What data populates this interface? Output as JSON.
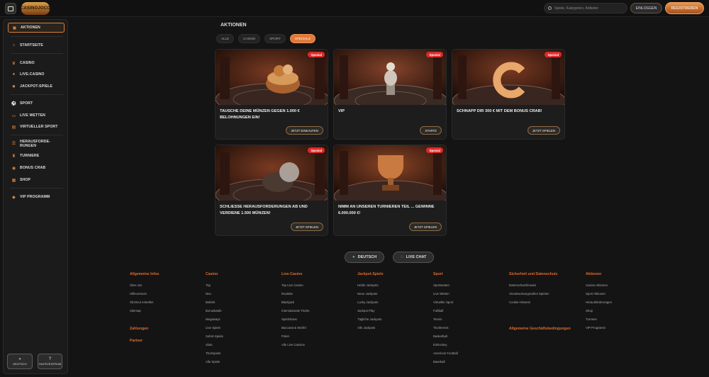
{
  "header": {
    "logo_text": "CASINOJOCO",
    "search_placeholder": "Spiele, Kategorien, Anbieter",
    "login_label": "EINLOGGEN",
    "register_label": "REGISTRIEREN"
  },
  "sidebar": {
    "items": [
      {
        "label": "AKTIONEN",
        "icon": "gift-icon"
      },
      {
        "label": "STARTSEITE",
        "icon": "home-icon"
      },
      {
        "label": "CASINO",
        "icon": "casino-icon"
      },
      {
        "label": "LIVE-CASINO",
        "icon": "live-casino-icon"
      },
      {
        "label": "JACKPOT-SPIELE",
        "icon": "jackpot-icon"
      },
      {
        "label": "SPORT",
        "icon": "sport-icon"
      },
      {
        "label": "LIVE WETTEN",
        "icon": "live-bet-icon"
      },
      {
        "label": "VIRTUELLER SPORT",
        "icon": "virtual-sport-icon"
      },
      {
        "label": "HERAUSFORDE-\nRUNGEN",
        "icon": "challenge-icon"
      },
      {
        "label": "TURNIERE",
        "icon": "trophy-icon"
      },
      {
        "label": "BONUS CRAB",
        "icon": "crab-icon"
      },
      {
        "label": "SHOP",
        "icon": "shop-icon"
      },
      {
        "label": "VIP PROGRAMM",
        "icon": "diamond-icon"
      }
    ],
    "bottom_language": "DEUTSCH",
    "bottom_help": "HILFECENTRUM"
  },
  "main": {
    "title": "AKTIONEN",
    "tabs": [
      "ALLE",
      "CASINO",
      "SPORT",
      "SPECIALS"
    ],
    "cards": [
      {
        "badge": "Spezial",
        "title": "TAUSCHE DEINE MÜNZEN GEGEN 1.000 € BELOHNUNGEN EIN!",
        "cta": "JETZT EINKAUFEN"
      },
      {
        "badge": "Spezial",
        "title": "VIP",
        "cta": "STARTE"
      },
      {
        "badge": "Spezial",
        "title": "SCHNAPP DIR 300 € MIT DEM BONUS CRAB!",
        "cta": "JETZT SPIELEN"
      },
      {
        "badge": "Spezial",
        "title": "SCHLIESSE HERAUSFORDERUNGEN AB UND VERDIENE 1.500 MÜNZEN!",
        "cta": "JETZT SPIELEN"
      },
      {
        "badge": "Spezial",
        "title": "NIMM AN UNSEREN TURNIEREN TEIL ... GEWINNE 6.000.000 €!",
        "cta": "JETZT SPIELEN"
      }
    ]
  },
  "footer": {
    "language_button": "DEUTSCH",
    "chat_button": "LIVE CHAT",
    "columns": [
      {
        "heading": "Allgemeine Infos",
        "links": [
          "Über uns",
          "Hilfecentrum",
          "Shortcut erstellen",
          "Sitemap"
        ]
      },
      {
        "heading": "Casino",
        "links": [
          "Top",
          "Neu",
          "Beliebt",
          "Bonuskäufe",
          "Megaways",
          "Live Spiele",
          "Sofort-Spiele",
          "Slots",
          "Tischspiele",
          "Alle Spiele"
        ]
      },
      {
        "heading": "Live-Casino",
        "links": [
          "Top Live Casino",
          "Roulette",
          "Blackjack",
          "Internationale Tische",
          "Spielshows",
          "Baccarat & Würfel",
          "Poker",
          "Alle Live Casinos"
        ]
      },
      {
        "heading": "Jackpot-Spiele",
        "links": [
          "Heiße Jackpots",
          "Neue Jackpots",
          "Lucky Jackpots",
          "Jackpot Play",
          "Tägliche Jackpots",
          "Alle Jackpots"
        ]
      },
      {
        "heading": "Sport",
        "links": [
          "Sportwetten",
          "Live Wetten",
          "Virtueller Sport",
          "Fußball",
          "Tennis",
          "Tischtennis",
          "Basketball",
          "Eishockey",
          "American Football",
          "Baseball"
        ]
      },
      {
        "heading": "Sicherheit und Datenschutz",
        "links": [
          "Datenschutzhinweis",
          "Verantwortungsvolles Spielen",
          "Cookie-Hinweis"
        ]
      },
      {
        "heading": "Aktionen",
        "links": [
          "Casino Aktionen",
          "Sport Aktionen",
          "Herausforderungen",
          "Shop",
          "Turniere",
          "VIP Programm"
        ]
      }
    ],
    "extra_headings": {
      "zahlungen": "Zahlungen",
      "partner": "Partner",
      "agb": "Allgemeine Geschäftsbedingungen"
    }
  },
  "colors": {
    "accent": "#e07a3a",
    "badge": "#d82b2b",
    "bg": "#141414"
  }
}
